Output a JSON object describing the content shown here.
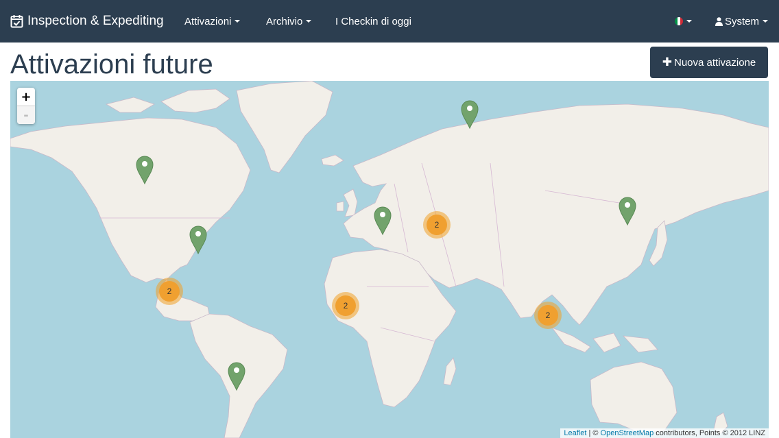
{
  "navbar": {
    "brand": "Inspection & Expediting",
    "menus": [
      "Attivazioni",
      "Archivio"
    ],
    "checkin": "I Checkin di oggi",
    "language_flag": [
      "#009246",
      "#ffffff",
      "#ce2b37"
    ],
    "user": "System"
  },
  "page": {
    "title": "Attivazioni future",
    "new_button": "Nuova attivazione"
  },
  "map": {
    "zoom_in": "+",
    "zoom_out": "-",
    "marker_color": "#72a36c",
    "cluster_color": "#f0a030",
    "markers": [
      {
        "id": "canada"
      },
      {
        "id": "sweden"
      },
      {
        "id": "eastern-usa"
      },
      {
        "id": "italy"
      },
      {
        "id": "northeast-china"
      },
      {
        "id": "bolivia"
      }
    ],
    "clusters": [
      "2",
      "2",
      "2",
      "2"
    ],
    "attribution": {
      "leaflet": "Leaflet",
      "sep": " | © ",
      "osm": "OpenStreetMap",
      "tail": " contributors, Points © 2012 LINZ"
    }
  }
}
